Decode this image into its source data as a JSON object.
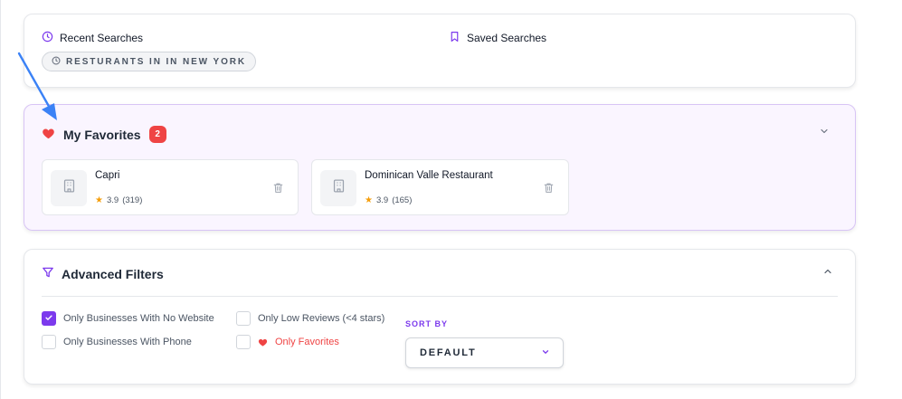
{
  "searches": {
    "recent_label": "Recent Searches",
    "saved_label": "Saved Searches",
    "recent_chip": "RESTURANTS IN IN NEW YORK"
  },
  "favorites": {
    "title": "My Favorites",
    "count": "2",
    "items": [
      {
        "name": "Capri",
        "rating": "3.9",
        "reviews": "(319)"
      },
      {
        "name": "Dominican Valle Restaurant",
        "rating": "3.9",
        "reviews": "(165)"
      }
    ]
  },
  "filters": {
    "title": "Advanced Filters",
    "options": {
      "no_website": {
        "label": "Only Businesses With No Website",
        "checked": true
      },
      "with_phone": {
        "label": "Only Businesses With Phone",
        "checked": false
      },
      "low_reviews": {
        "label": "Only Low Reviews (<4 stars)",
        "checked": false
      },
      "only_favorites": {
        "label": "Only Favorites",
        "checked": false
      }
    },
    "sort_by_label": "SORT BY",
    "sort_by_value": "DEFAULT"
  },
  "colors": {
    "accent": "#7c3aed",
    "favorite_red": "#ef4444",
    "favorites_bg": "#faf5ff",
    "star": "#f59e0b",
    "annotation_arrow": "#3b82f6"
  },
  "icons": {
    "recent": "clock-icon",
    "saved": "bookmark-icon",
    "favorites": "heart-icon",
    "business": "building-icon",
    "delete": "trash-icon",
    "filter": "funnel-icon",
    "collapse": "chevron-down-icon",
    "expand": "chevron-up-icon",
    "select": "chevron-down-icon"
  }
}
